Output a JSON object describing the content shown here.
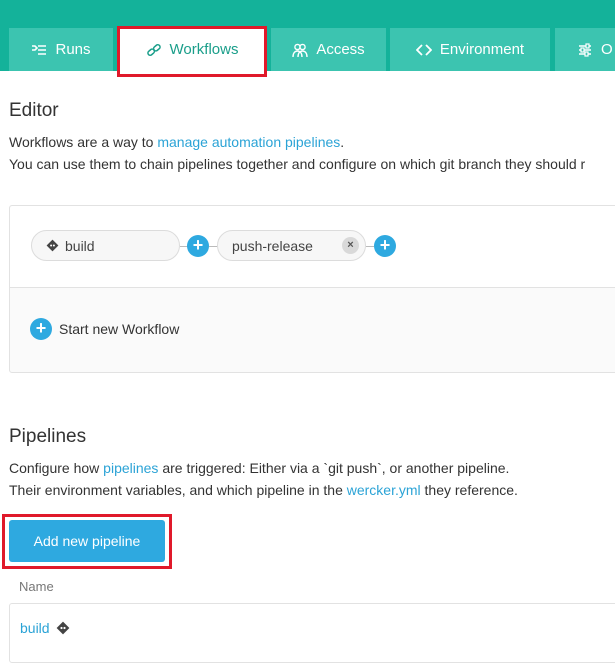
{
  "tabs": [
    {
      "label": "Runs",
      "icon": "list-icon",
      "active": false
    },
    {
      "label": "Workflows",
      "icon": "link-icon",
      "active": true
    },
    {
      "label": "Access",
      "icon": "people-icon",
      "active": false
    },
    {
      "label": "Environment",
      "icon": "code-icon",
      "active": false
    },
    {
      "label": "O",
      "icon": "sliders-icon",
      "active": false
    }
  ],
  "editor": {
    "heading": "Editor",
    "line1_prefix": "Workflows are a way to ",
    "line1_link": "manage automation pipelines",
    "line1_suffix": ".",
    "line2": "You can use them to chain pipelines together and configure on which git branch they should r",
    "nodes": [
      {
        "label": "build"
      },
      {
        "label": "push-release"
      }
    ],
    "remove_symbol": "×",
    "add_symbol": "+",
    "start_label": "Start new Workflow"
  },
  "pipelines": {
    "heading": "Pipelines",
    "line1_prefix": "Configure how ",
    "line1_link": "pipelines",
    "line1_suffix": " are triggered: Either via a `git push`, or another pipeline.",
    "line2_prefix": "Their environment variables, and which pipeline in the ",
    "line2_link": "wercker.yml",
    "line2_suffix": " they reference.",
    "add_button": "Add new pipeline",
    "column_name": "Name",
    "rows": [
      {
        "name": "build"
      }
    ]
  },
  "colors": {
    "header": "#14b29a",
    "tab": "#3cc4b0",
    "accent": "#2ea9e0",
    "highlight": "#e0192a"
  }
}
